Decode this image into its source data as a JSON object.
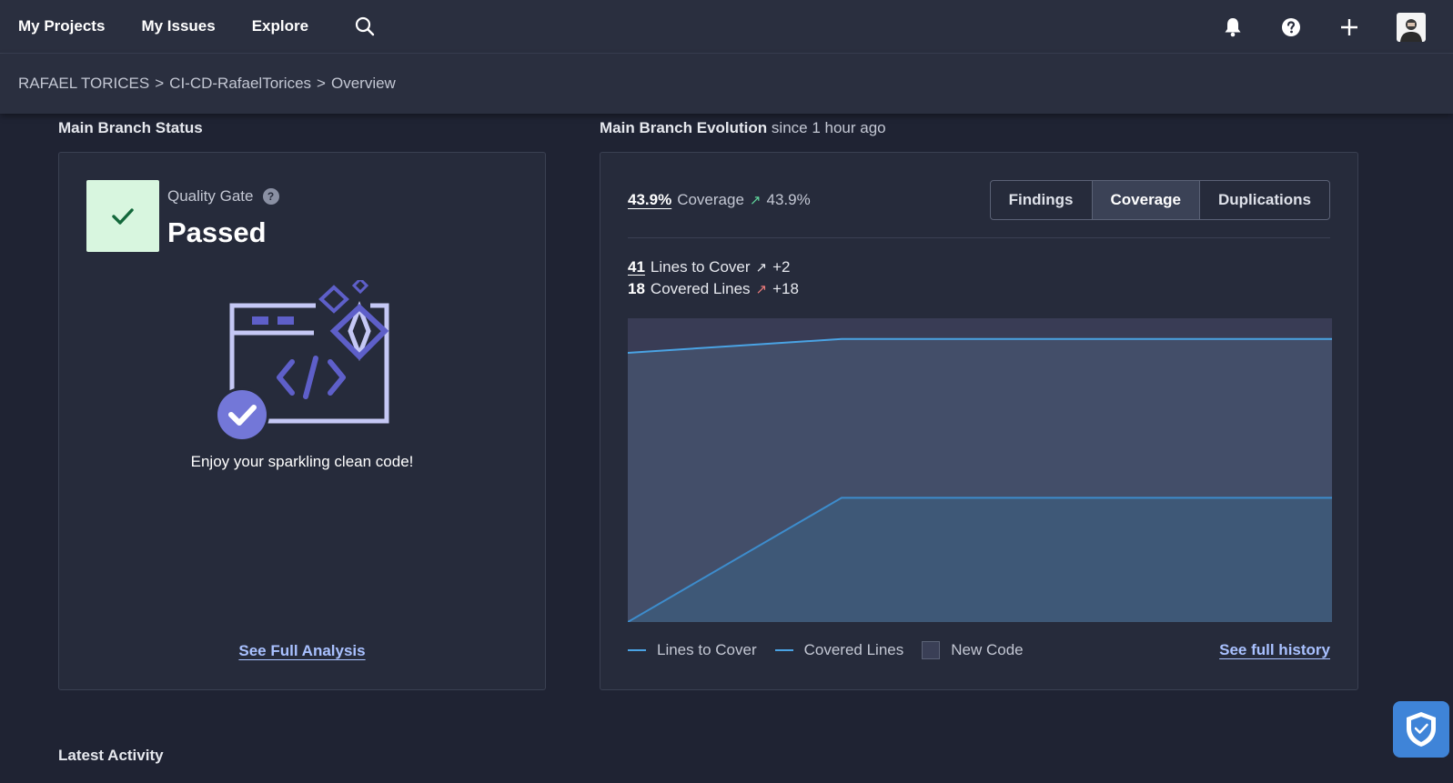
{
  "nav": {
    "items": [
      "My Projects",
      "My Issues",
      "Explore"
    ]
  },
  "breadcrumb": {
    "org": "RAFAEL TORICES",
    "project": "CI-CD-RafaelTorices",
    "page": "Overview",
    "separator": ">"
  },
  "status": {
    "title": "Main Branch Status",
    "qg_label": "Quality Gate",
    "help_glyph": "?",
    "qg_status": "Passed",
    "message": "Enjoy your sparkling clean code!",
    "link": "See Full Analysis"
  },
  "evolution": {
    "title": "Main Branch Evolution",
    "since": "since 1 hour ago",
    "coverage_value": "43.9%",
    "coverage_label": "Coverage",
    "coverage_delta": "43.9%",
    "tabs": [
      "Findings",
      "Coverage",
      "Duplications"
    ],
    "active_tab": "Coverage",
    "lines_to_cover_value": "41",
    "lines_to_cover_label": "Lines to Cover",
    "lines_to_cover_delta": "+2",
    "covered_lines_value": "18",
    "covered_lines_label": "Covered Lines",
    "covered_lines_delta": "+18",
    "history_link": "See full history"
  },
  "chart_data": {
    "type": "area",
    "series": [
      {
        "name": "Lines to Cover",
        "values": [
          39,
          41,
          41
        ]
      },
      {
        "name": "Covered Lines",
        "values": [
          0,
          18,
          18
        ]
      }
    ],
    "legend": [
      "Lines to Cover",
      "Covered Lines",
      "New Code"
    ],
    "new_code": "New Code",
    "ylim": [
      0,
      44
    ],
    "grid": false
  },
  "activity": {
    "title": "Latest Activity"
  },
  "colors": {
    "background": "#1f2333",
    "panel": "#262b3b",
    "link": "#a9c1ff",
    "passed": "#d8f6df",
    "line": "#4aa3e4",
    "delta_up_green": "#5fd39a",
    "delta_up_red": "#e87a7a",
    "illustration": "#c5c8f5",
    "illustration_accent": "#5e5fc9"
  },
  "icons": {
    "search": "search-icon",
    "bell": "bell-icon",
    "help": "help-circle-icon",
    "plus": "plus-icon",
    "shield": "shield-check-icon"
  }
}
